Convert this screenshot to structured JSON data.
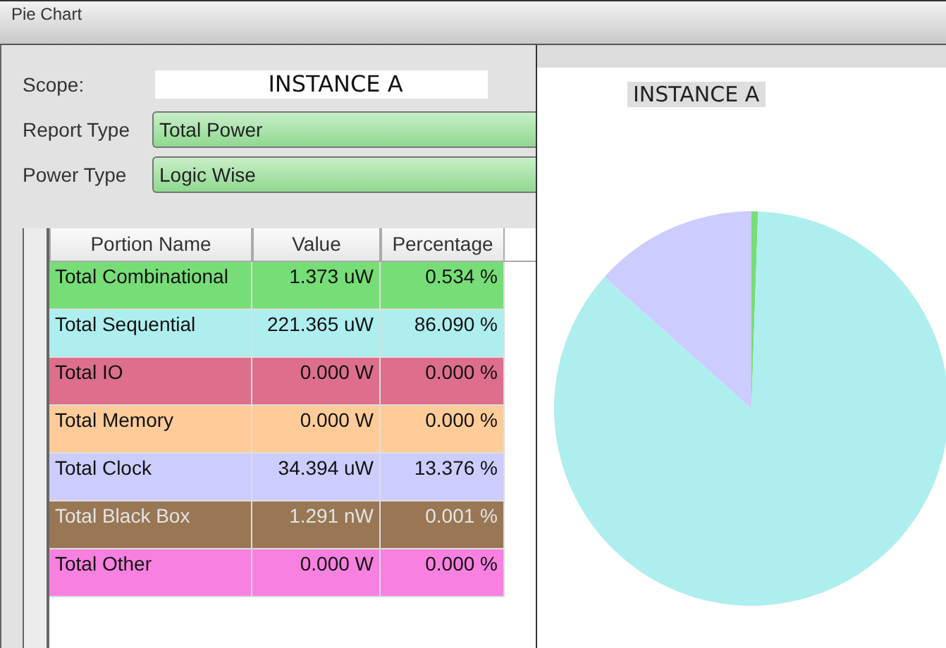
{
  "window": {
    "title": "Pie Chart"
  },
  "form": {
    "scope_label": "Scope:",
    "scope_value": "INSTANCE A",
    "report_type_label": "Report Type",
    "report_type_value": "Total Power",
    "power_type_label": "Power Type",
    "power_type_value": "Logic Wise"
  },
  "table": {
    "columns": [
      "Portion Name",
      "Value",
      "Percentage"
    ],
    "rows": [
      {
        "name": "Total Combinational",
        "value": "1.373 uW",
        "percentage": "0.534 %",
        "color": "#77dd77"
      },
      {
        "name": "Total Sequential",
        "value": "221.365 uW",
        "percentage": "86.090 %",
        "color": "#aeeeee"
      },
      {
        "name": "Total IO",
        "value": "0.000 W",
        "percentage": "0.000 %",
        "color": "#dd6f8c"
      },
      {
        "name": "Total Memory",
        "value": "0.000 W",
        "percentage": "0.000 %",
        "color": "#ffcc99"
      },
      {
        "name": "Total Clock",
        "value": "34.394 uW",
        "percentage": "13.376 %",
        "color": "#ccccff"
      },
      {
        "name": "Total Black Box",
        "value": "1.291 nW",
        "percentage": "0.001 %",
        "color": "#997755"
      },
      {
        "name": "Total Other",
        "value": "0.000 W",
        "percentage": "0.000 %",
        "color": "#f880e0"
      }
    ]
  },
  "chart": {
    "title": "INSTANCE A"
  }
}
